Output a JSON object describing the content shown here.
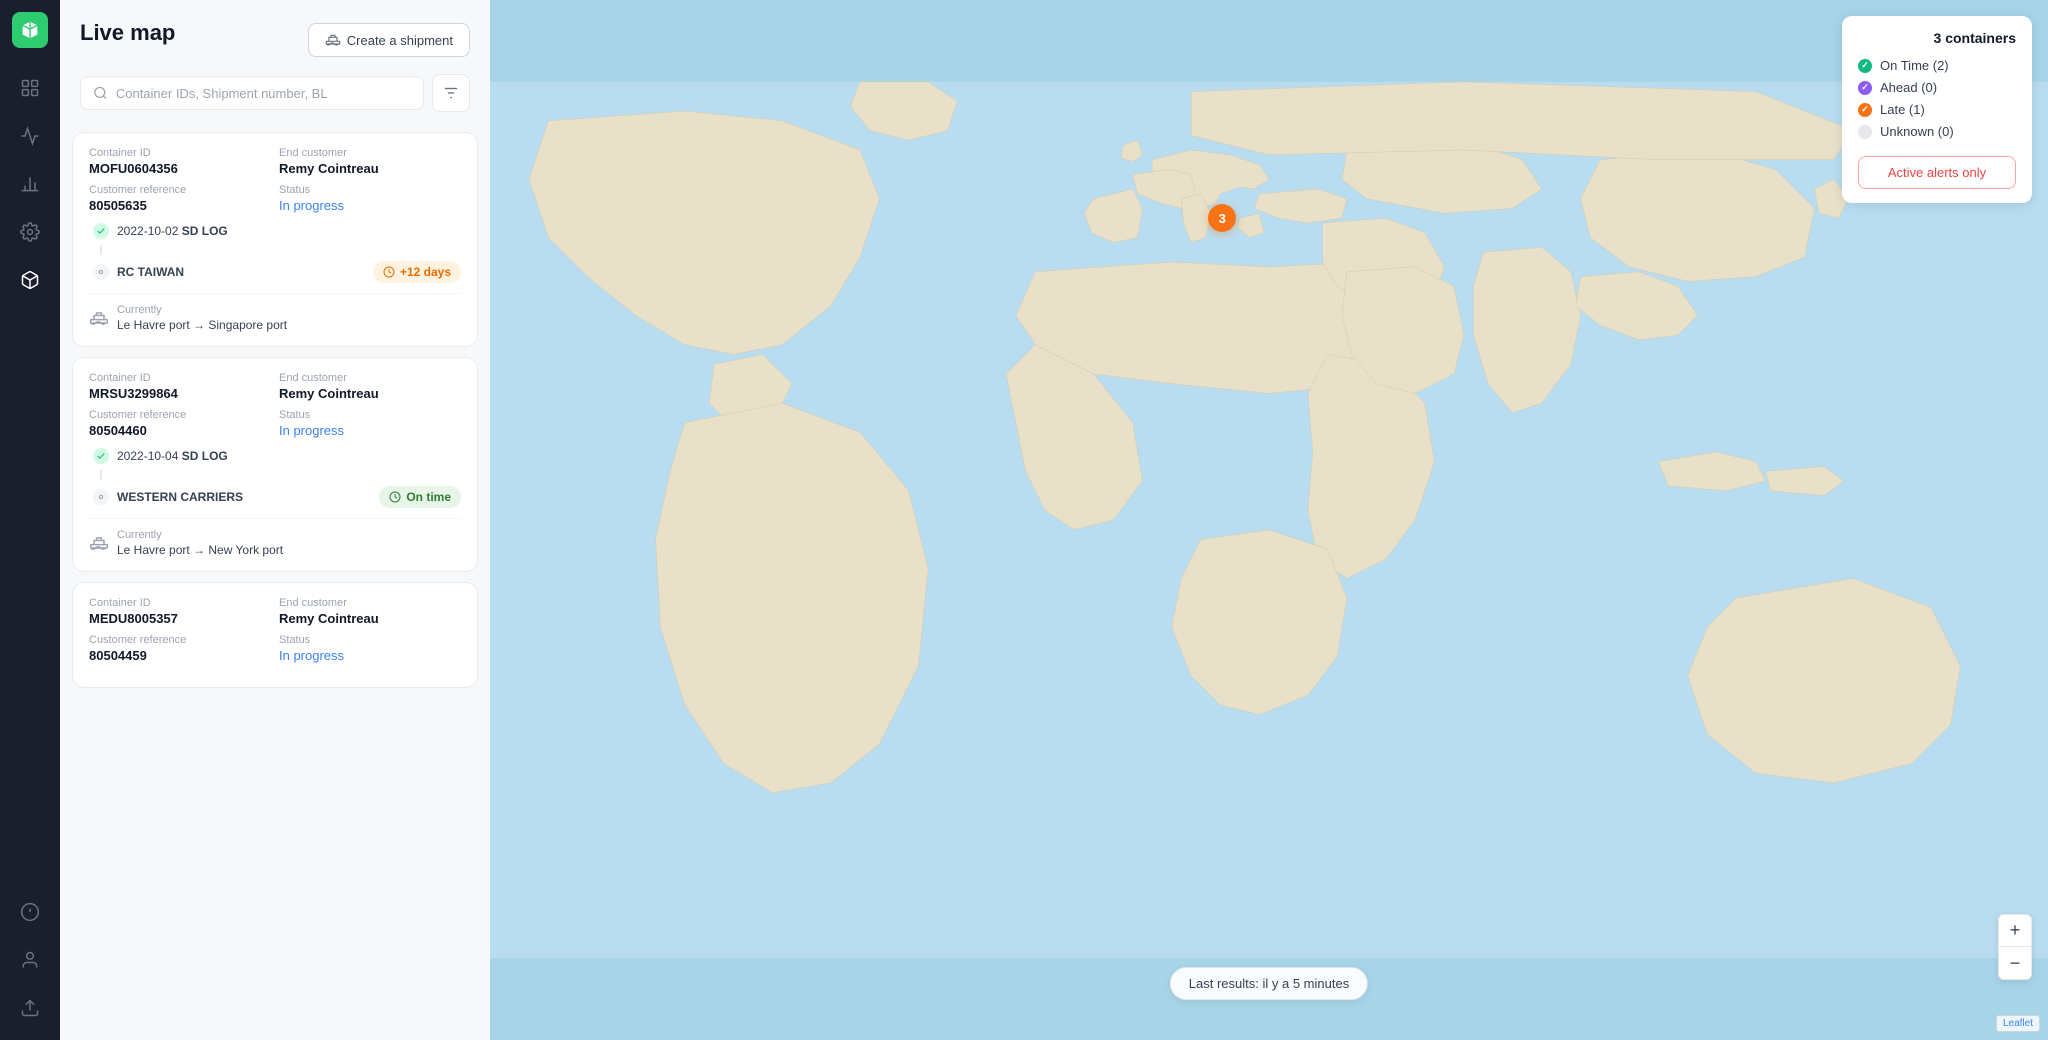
{
  "app": {
    "logo_alt": "Shippeo logo"
  },
  "sidebar": {
    "items": [
      {
        "id": "dashboard",
        "icon": "grid-icon",
        "active": false
      },
      {
        "id": "analytics",
        "icon": "chart-icon",
        "active": false
      },
      {
        "id": "bar-chart",
        "icon": "bar-chart-icon",
        "active": false
      },
      {
        "id": "settings",
        "icon": "settings-icon",
        "active": false
      },
      {
        "id": "package",
        "icon": "package-icon",
        "active": true
      },
      {
        "id": "info",
        "icon": "info-icon",
        "active": false
      },
      {
        "id": "user",
        "icon": "user-icon",
        "active": false
      },
      {
        "id": "upload",
        "icon": "upload-icon",
        "active": false
      }
    ]
  },
  "header": {
    "title": "Live map",
    "create_shipment_label": "Create a shipment"
  },
  "search": {
    "placeholder": "Container IDs, Shipment number, BL"
  },
  "shipments": [
    {
      "container_id_label": "Container ID",
      "container_id": "MOFU0604356",
      "end_customer_label": "End customer",
      "end_customer": "Remy Cointreau",
      "customer_ref_label": "Customer reference",
      "customer_ref": "80505635",
      "status_label": "Status",
      "status": "In progress",
      "timeline_start_date": "2022-10-02",
      "timeline_start_carrier": "SD LOG",
      "timeline_end": "RC TAIWAN",
      "badge_type": "late",
      "badge_text": "+12 days",
      "currently_label": "Currently",
      "currently_route": "Le Havre port → Singapore port"
    },
    {
      "container_id_label": "Container ID",
      "container_id": "MRSU3299864",
      "end_customer_label": "End customer",
      "end_customer": "Remy Cointreau",
      "customer_ref_label": "Customer reference",
      "customer_ref": "80504460",
      "status_label": "Status",
      "status": "In progress",
      "timeline_start_date": "2022-10-04",
      "timeline_start_carrier": "SD LOG",
      "timeline_end": "WESTERN CARRIERS",
      "badge_type": "on-time",
      "badge_text": "On time",
      "currently_label": "Currently",
      "currently_route": "Le Havre port → New York port"
    },
    {
      "container_id_label": "Container ID",
      "container_id": "MEDU8005357",
      "end_customer_label": "End customer",
      "end_customer": "Remy Cointreau",
      "customer_ref_label": "Customer reference",
      "customer_ref": "80504459",
      "status_label": "Status",
      "status": "In progress",
      "timeline_start_date": "",
      "timeline_start_carrier": "",
      "timeline_end": "",
      "badge_type": "",
      "badge_text": "",
      "currently_label": "",
      "currently_route": ""
    }
  ],
  "map": {
    "containers_title": "3 containers",
    "legend": [
      {
        "id": "on-time",
        "label": "On Time (2)",
        "color": "#10b981"
      },
      {
        "id": "ahead",
        "label": "Ahead (0)",
        "color": "#8b5cf6"
      },
      {
        "id": "late",
        "label": "Late (1)",
        "color": "#f97316"
      },
      {
        "id": "unknown",
        "label": "Unknown (0)",
        "color": "#d1d5db"
      }
    ],
    "active_alerts_label": "Active alerts only",
    "pin_count": "3",
    "last_results": "Last results: il y a 5 minutes",
    "zoom_in": "+",
    "zoom_out": "−",
    "leaflet_label": "Leaflet"
  }
}
